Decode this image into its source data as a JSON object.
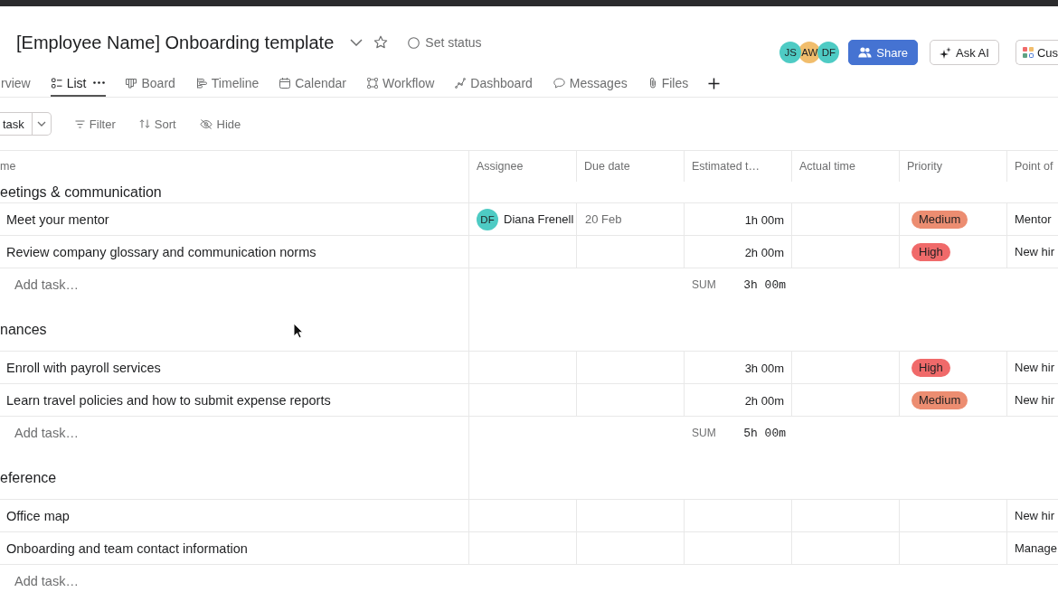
{
  "project": {
    "title": "[Employee Name] Onboarding template",
    "status": "Set status"
  },
  "members": [
    {
      "initials": "JS",
      "color": "#4ecbc4"
    },
    {
      "initials": "AW",
      "color": "#f1bd6c"
    },
    {
      "initials": "DF",
      "color": "#4ecbc4"
    }
  ],
  "actions": [
    {
      "kind": "share",
      "label": "Share"
    },
    {
      "kind": "ai",
      "label": "Ask AI"
    },
    {
      "kind": "customize",
      "label": "Cus"
    }
  ],
  "tabs": [
    {
      "kind": "overview",
      "label": "rview",
      "selected": false
    },
    {
      "kind": "list",
      "label": "List",
      "selected": true
    },
    {
      "kind": "board",
      "label": "Board",
      "selected": false
    },
    {
      "kind": "timeline",
      "label": "Timeline",
      "selected": false
    },
    {
      "kind": "calendar",
      "label": "Calendar",
      "selected": false
    },
    {
      "kind": "workflow",
      "label": "Workflow",
      "selected": false
    },
    {
      "kind": "dashboard",
      "label": "Dashboard",
      "selected": false
    },
    {
      "kind": "messages",
      "label": "Messages",
      "selected": false
    },
    {
      "kind": "files",
      "label": "Files",
      "selected": false
    }
  ],
  "toolbar": {
    "add_task": "task",
    "tools": [
      {
        "kind": "filter",
        "label": "Filter"
      },
      {
        "kind": "sort",
        "label": "Sort"
      },
      {
        "kind": "hide",
        "label": "Hide"
      }
    ]
  },
  "table": {
    "columns": [
      "me",
      "Assignee",
      "Due date",
      "Estimated t…",
      "Actual time",
      "Priority",
      "Point of"
    ],
    "sections": [
      {
        "title": "eetings & communication",
        "tasks": [
          {
            "name": "Meet your mentor",
            "assignee": {
              "initials": "DF",
              "name": "Diana Frenell",
              "color": "#4ecbc4"
            },
            "due_date": "20 Feb",
            "estimated_time": "1h 00m",
            "priority": {
              "label": "Medium",
              "color": "#ec8d71"
            },
            "point_of": "Mentor"
          },
          {
            "name": "Review company glossary and communication norms",
            "estimated_time": "2h 00m",
            "priority": {
              "label": "High",
              "color": "#f06a6a"
            },
            "point_of": "New hir"
          }
        ],
        "add_task": "Add task…",
        "sum": {
          "label": "SUM",
          "value": "3h 00m"
        }
      },
      {
        "title": "nances",
        "tasks": [
          {
            "name": "Enroll with payroll services",
            "estimated_time": "3h 00m",
            "priority": {
              "label": "High",
              "color": "#f06a6a"
            },
            "point_of": "New hir"
          },
          {
            "name": "Learn travel policies and how to submit expense reports",
            "estimated_time": "2h 00m",
            "priority": {
              "label": "Medium",
              "color": "#ec8d71"
            },
            "point_of": "New hir"
          }
        ],
        "add_task": "Add task…",
        "sum": {
          "label": "SUM",
          "value": "5h 00m"
        }
      },
      {
        "title": "eference",
        "tasks": [
          {
            "name": "Office map",
            "point_of": "New hir"
          },
          {
            "name": "Onboarding and team contact information",
            "point_of": "Manage"
          }
        ],
        "add_task": "Add task…"
      }
    ]
  }
}
